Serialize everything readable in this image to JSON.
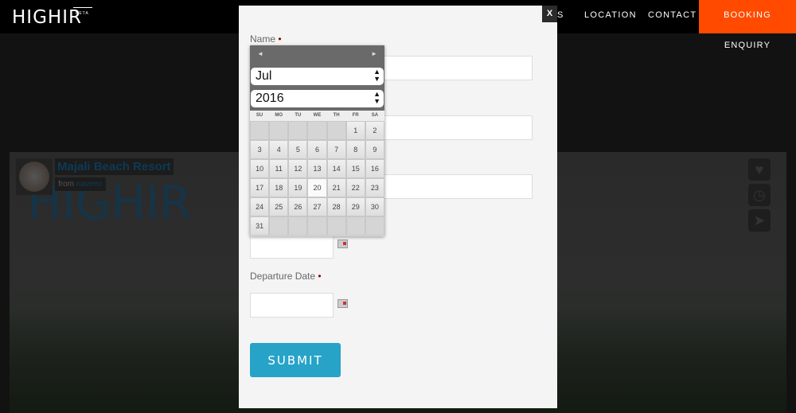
{
  "header": {
    "logo": "HIGHIR",
    "badge": "BETA",
    "nav": [
      "S",
      "LOCATION",
      "CONTACT"
    ],
    "booking": "BOOKING ENQUIRY",
    "booking_color": "#ff4a00"
  },
  "listing": {
    "title": "Majali Beach Resort",
    "from_label": "from",
    "author": "naveen",
    "logo_watermark": "HIGHIR"
  },
  "side_icons": [
    "heart-icon",
    "clock-icon",
    "send-icon"
  ],
  "modal": {
    "close": "X",
    "name_label": "Name",
    "departure_label": "Departure Date",
    "required_mark": "•",
    "submit": "SUBMIT",
    "submit_color": "#27a3c8"
  },
  "calendar": {
    "prev": "◄",
    "next": "►",
    "month": "Jul",
    "year": "2016",
    "weekdays": [
      "SU",
      "MO",
      "TU",
      "WE",
      "TH",
      "FR",
      "SA"
    ],
    "first_weekday": 5,
    "days": 31,
    "today": 20
  }
}
